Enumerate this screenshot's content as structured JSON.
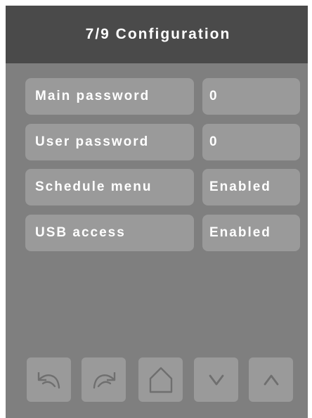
{
  "header": {
    "title": "7/9 Configuration"
  },
  "settings": [
    {
      "label": "Main password",
      "value": "0"
    },
    {
      "label": "User password",
      "value": "0"
    },
    {
      "label": "Schedule menu",
      "value": "Enabled"
    },
    {
      "label": "USB access",
      "value": "Enabled"
    }
  ],
  "nav": {
    "icons": [
      "back-arrow-icon",
      "forward-arrow-icon",
      "home-icon",
      "chevron-down-icon",
      "chevron-up-icon"
    ]
  },
  "colors": {
    "background": "#7f7f7f",
    "header": "#4a4a4a",
    "cell": "#9a9a9a",
    "text": "#ffffff",
    "icon": "#6f6f6f"
  }
}
